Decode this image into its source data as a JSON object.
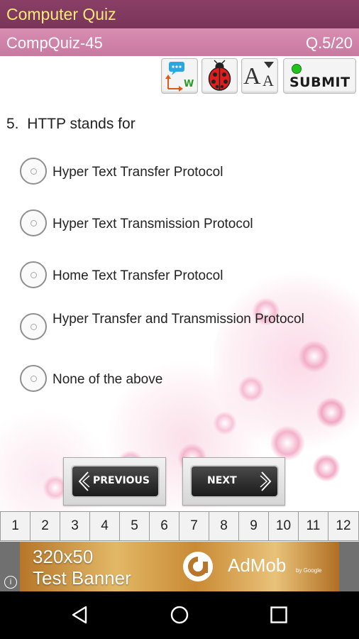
{
  "app_title": "Computer Quiz",
  "quiz": {
    "name": "CompQuiz-45",
    "counter": "Q.5/20"
  },
  "toolbar": {
    "buttons": [
      {
        "name": "translate-button",
        "icon": "translate-icon",
        "label": "W"
      },
      {
        "name": "report-bug-button",
        "icon": "ladybug-icon"
      },
      {
        "name": "font-size-button",
        "icon": "font-size-icon",
        "label_big": "A",
        "label_small": "A"
      },
      {
        "name": "submit-button",
        "icon": "green-dot-icon",
        "label": "SUBMIT"
      }
    ]
  },
  "question": {
    "number": "5.",
    "text": "HTTP stands for",
    "options": [
      "Hyper Text Transfer Protocol",
      "Hyper Text Transmission Protocol",
      "Home Text Transfer Protocol",
      "Hyper Transfer and Transmission Protocol",
      "None of the above"
    ]
  },
  "nav": {
    "previous_label": "PREVIOUS",
    "next_label": "NEXT"
  },
  "pager": {
    "pages": [
      "1",
      "2",
      "3",
      "4",
      "5",
      "6",
      "7",
      "8",
      "9",
      "10",
      "11",
      "12"
    ]
  },
  "ad": {
    "line1": "320x50",
    "line2": "Test Banner",
    "brand": "AdMob",
    "byline": "by Google",
    "info": "i"
  },
  "colors": {
    "title_bar": "#7a3459",
    "title_text": "#ffe97a",
    "header_bar": "#cf82a8",
    "accent_green": "#22c21f"
  }
}
